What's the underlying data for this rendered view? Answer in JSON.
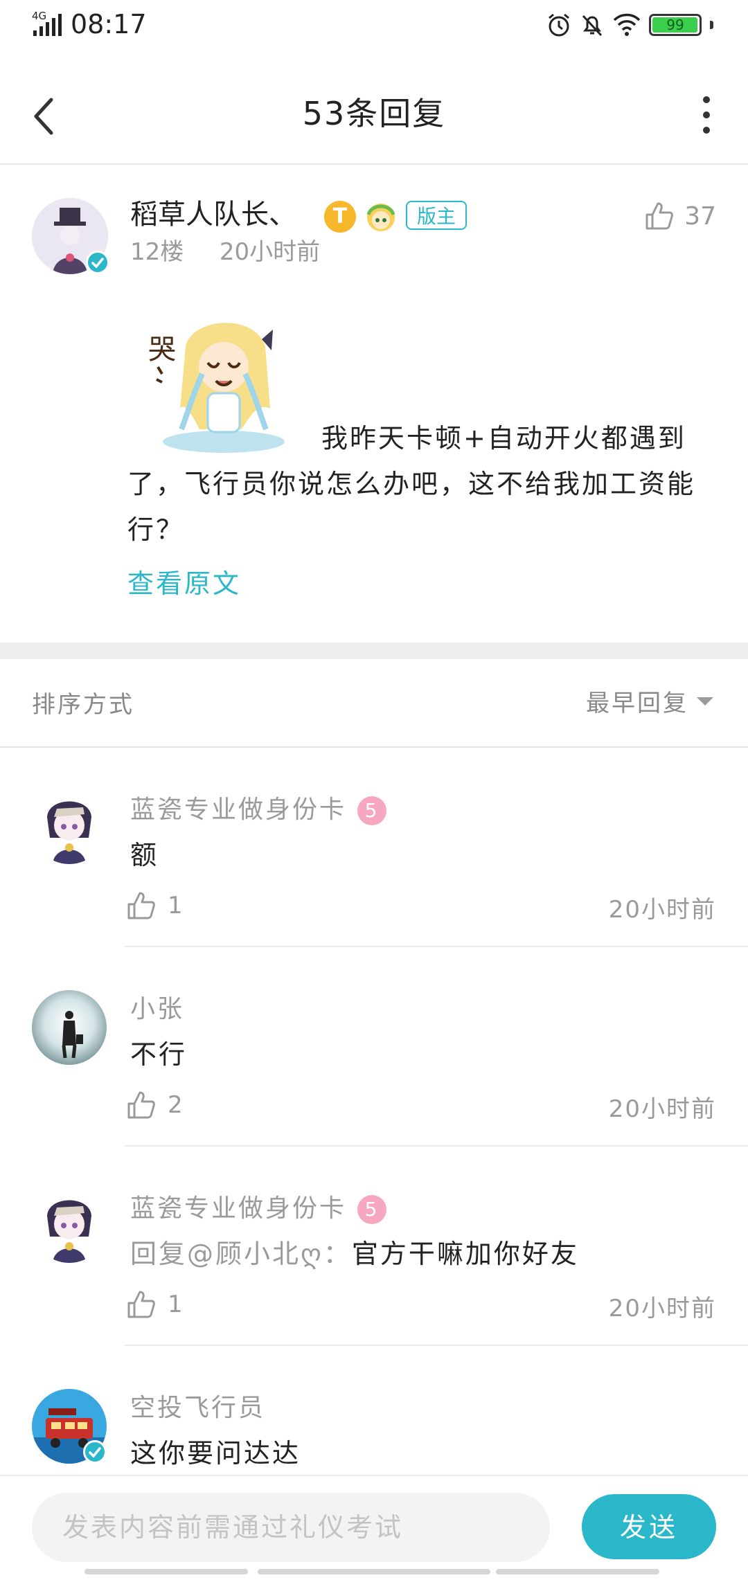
{
  "status_bar": {
    "network": "4G",
    "time": "08:17",
    "battery": "99",
    "battery_level": 0.99
  },
  "header": {
    "title": "53条回复"
  },
  "post": {
    "username": "稻草人队长、",
    "level_badge": "T",
    "role_badge": "版主",
    "floor": "12楼",
    "time": "20小时前",
    "like_count": "37",
    "body": "我昨天卡顿+自动开火都遇到了，飞行员你说怎么办吧，这不给我加工资能行？",
    "sticker_text": "哭",
    "view_original": "查看原文"
  },
  "sort": {
    "label": "排序方式",
    "selected": "最早回复"
  },
  "replies": [
    {
      "name": "蓝瓷专业做身份卡",
      "level": "5",
      "mention": "",
      "text": "额",
      "likes": "1",
      "time": "20小时前"
    },
    {
      "name": "小张",
      "level": "",
      "mention": "",
      "text": "不行",
      "likes": "2",
      "time": "20小时前"
    },
    {
      "name": "蓝瓷专业做身份卡",
      "level": "5",
      "mention": "回复@顾小北ღ：",
      "text": "官方干嘛加你好友",
      "likes": "1",
      "time": "20小时前"
    },
    {
      "name": "空投飞行员",
      "level": "",
      "mention": "",
      "text": "这你要问达达",
      "likes": "",
      "time": ""
    }
  ],
  "composer": {
    "placeholder": "发表内容前需通过礼仪考试",
    "send": "发送"
  },
  "colors": {
    "accent": "#2ab7c9",
    "muted": "#9a9a9a",
    "level_pink": "#f7a7c0",
    "badge_gold": "#f6b82a"
  }
}
